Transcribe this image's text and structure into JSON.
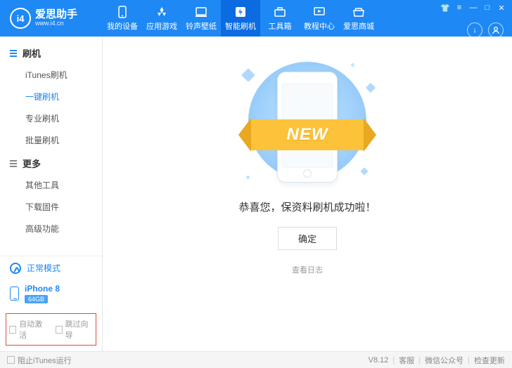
{
  "brand": {
    "name": "爱思助手",
    "url": "www.i4.cn",
    "logo_text": "i4"
  },
  "nav": [
    {
      "label": "我的设备",
      "icon": "phone",
      "active": false
    },
    {
      "label": "应用游戏",
      "icon": "apps",
      "active": false
    },
    {
      "label": "铃声壁纸",
      "icon": "media",
      "active": false
    },
    {
      "label": "智能刷机",
      "icon": "flash",
      "active": true
    },
    {
      "label": "工具箱",
      "icon": "toolbox",
      "active": false
    },
    {
      "label": "教程中心",
      "icon": "tutorial",
      "active": false
    },
    {
      "label": "爱思商城",
      "icon": "store",
      "active": false
    }
  ],
  "sidebar": {
    "flash_title": "刷机",
    "flash_items": [
      "iTunes刷机",
      "一键刷机",
      "专业刷机",
      "批量刷机"
    ],
    "flash_active_index": 1,
    "more_title": "更多",
    "more_items": [
      "其他工具",
      "下载固件",
      "高级功能"
    ],
    "mode_label": "正常模式",
    "device": {
      "name": "iPhone 8",
      "capacity": "64GB"
    },
    "options": [
      "自动激活",
      "跳过向导"
    ]
  },
  "main": {
    "ribbon": "NEW",
    "message": "恭喜您，保资料刷机成功啦！",
    "ok": "确定",
    "log": "查看日志"
  },
  "footer": {
    "block_itunes": "阻止iTunes运行",
    "version": "V8.12",
    "svc": "客服",
    "wechat": "微信公众号",
    "update": "检查更新"
  }
}
